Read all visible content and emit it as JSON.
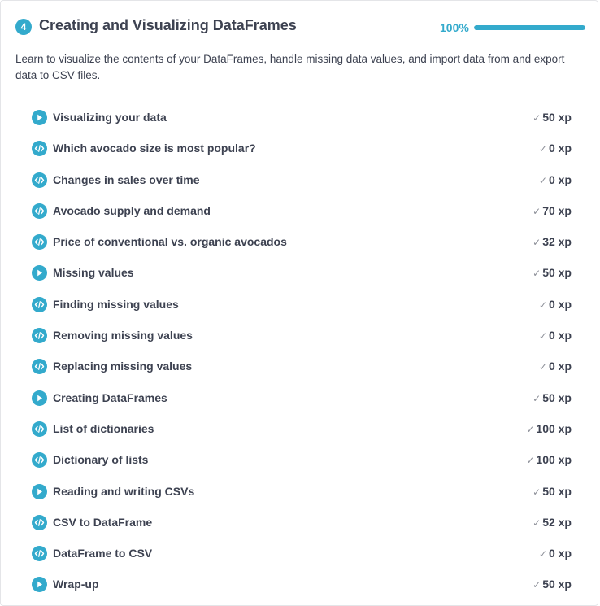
{
  "chapter": {
    "number": "4",
    "title": "Creating and Visualizing DataFrames",
    "progress_label": "100%",
    "progress_fraction": 1.0,
    "description": "Learn to visualize the contents of your DataFrames, handle missing data values, and import data from and export data to CSV files."
  },
  "colors": {
    "accent": "#33aacc",
    "text": "#3d4251",
    "track": "#e4e5e8"
  },
  "check_glyph": "✓",
  "exercises": [
    {
      "icon": "video-icon",
      "title": "Visualizing your data",
      "xp": "50 xp"
    },
    {
      "icon": "code-icon",
      "title": "Which avocado size is most popular?",
      "xp": "0 xp"
    },
    {
      "icon": "code-icon",
      "title": "Changes in sales over time",
      "xp": "0 xp"
    },
    {
      "icon": "code-icon",
      "title": "Avocado supply and demand",
      "xp": "70 xp"
    },
    {
      "icon": "code-icon",
      "title": "Price of conventional vs. organic avocados",
      "xp": "32 xp"
    },
    {
      "icon": "video-icon",
      "title": "Missing values",
      "xp": "50 xp"
    },
    {
      "icon": "code-icon",
      "title": "Finding missing values",
      "xp": "0 xp"
    },
    {
      "icon": "code-icon",
      "title": "Removing missing values",
      "xp": "0 xp"
    },
    {
      "icon": "code-icon",
      "title": "Replacing missing values",
      "xp": "0 xp"
    },
    {
      "icon": "video-icon",
      "title": "Creating DataFrames",
      "xp": "50 xp"
    },
    {
      "icon": "code-icon",
      "title": "List of dictionaries",
      "xp": "100 xp"
    },
    {
      "icon": "code-icon",
      "title": "Dictionary of lists",
      "xp": "100 xp"
    },
    {
      "icon": "video-icon",
      "title": "Reading and writing CSVs",
      "xp": "50 xp"
    },
    {
      "icon": "code-icon",
      "title": "CSV to DataFrame",
      "xp": "52 xp"
    },
    {
      "icon": "code-icon",
      "title": "DataFrame to CSV",
      "xp": "0 xp"
    },
    {
      "icon": "video-icon",
      "title": "Wrap-up",
      "xp": "50 xp"
    }
  ]
}
